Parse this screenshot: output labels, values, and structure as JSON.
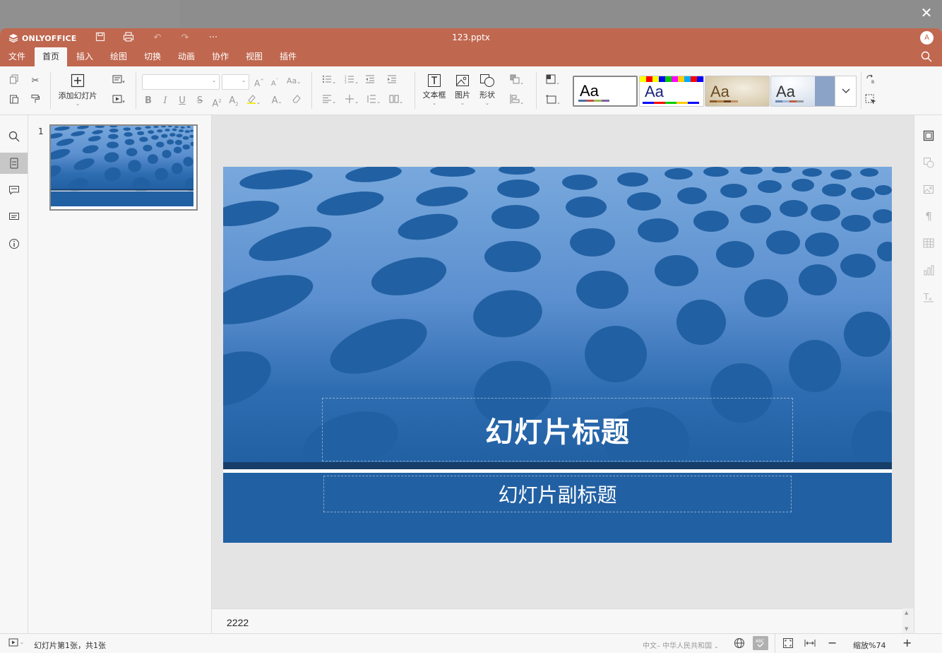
{
  "app": {
    "name": "ONLYOFFICE",
    "document_title": "123.pptx",
    "user_initial": "A"
  },
  "menu": {
    "tabs": [
      {
        "label": "文件"
      },
      {
        "label": "首页"
      },
      {
        "label": "插入"
      },
      {
        "label": "绘图"
      },
      {
        "label": "切换"
      },
      {
        "label": "动画"
      },
      {
        "label": "协作"
      },
      {
        "label": "视图"
      },
      {
        "label": "插件"
      }
    ],
    "active_tab": "首页"
  },
  "toolbar": {
    "add_slide_label": "添加幻灯片",
    "textbox_label": "文本框",
    "image_label": "图片",
    "shape_label": "形状",
    "theme_sample": "Aa"
  },
  "thumbnails": {
    "slide_number": "1"
  },
  "slide": {
    "title": "幻灯片标题",
    "subtitle": "幻灯片副标题"
  },
  "notes": {
    "text": "2222"
  },
  "status": {
    "slide_info": "幻灯片第1张，共1张",
    "language": "中文– 中华人民共和国",
    "zoom": "缩放%74"
  },
  "colors": {
    "accent": "#c0674f",
    "slide_blue_dark": "#2160a3",
    "slide_blue_light": "#78a8dc"
  }
}
